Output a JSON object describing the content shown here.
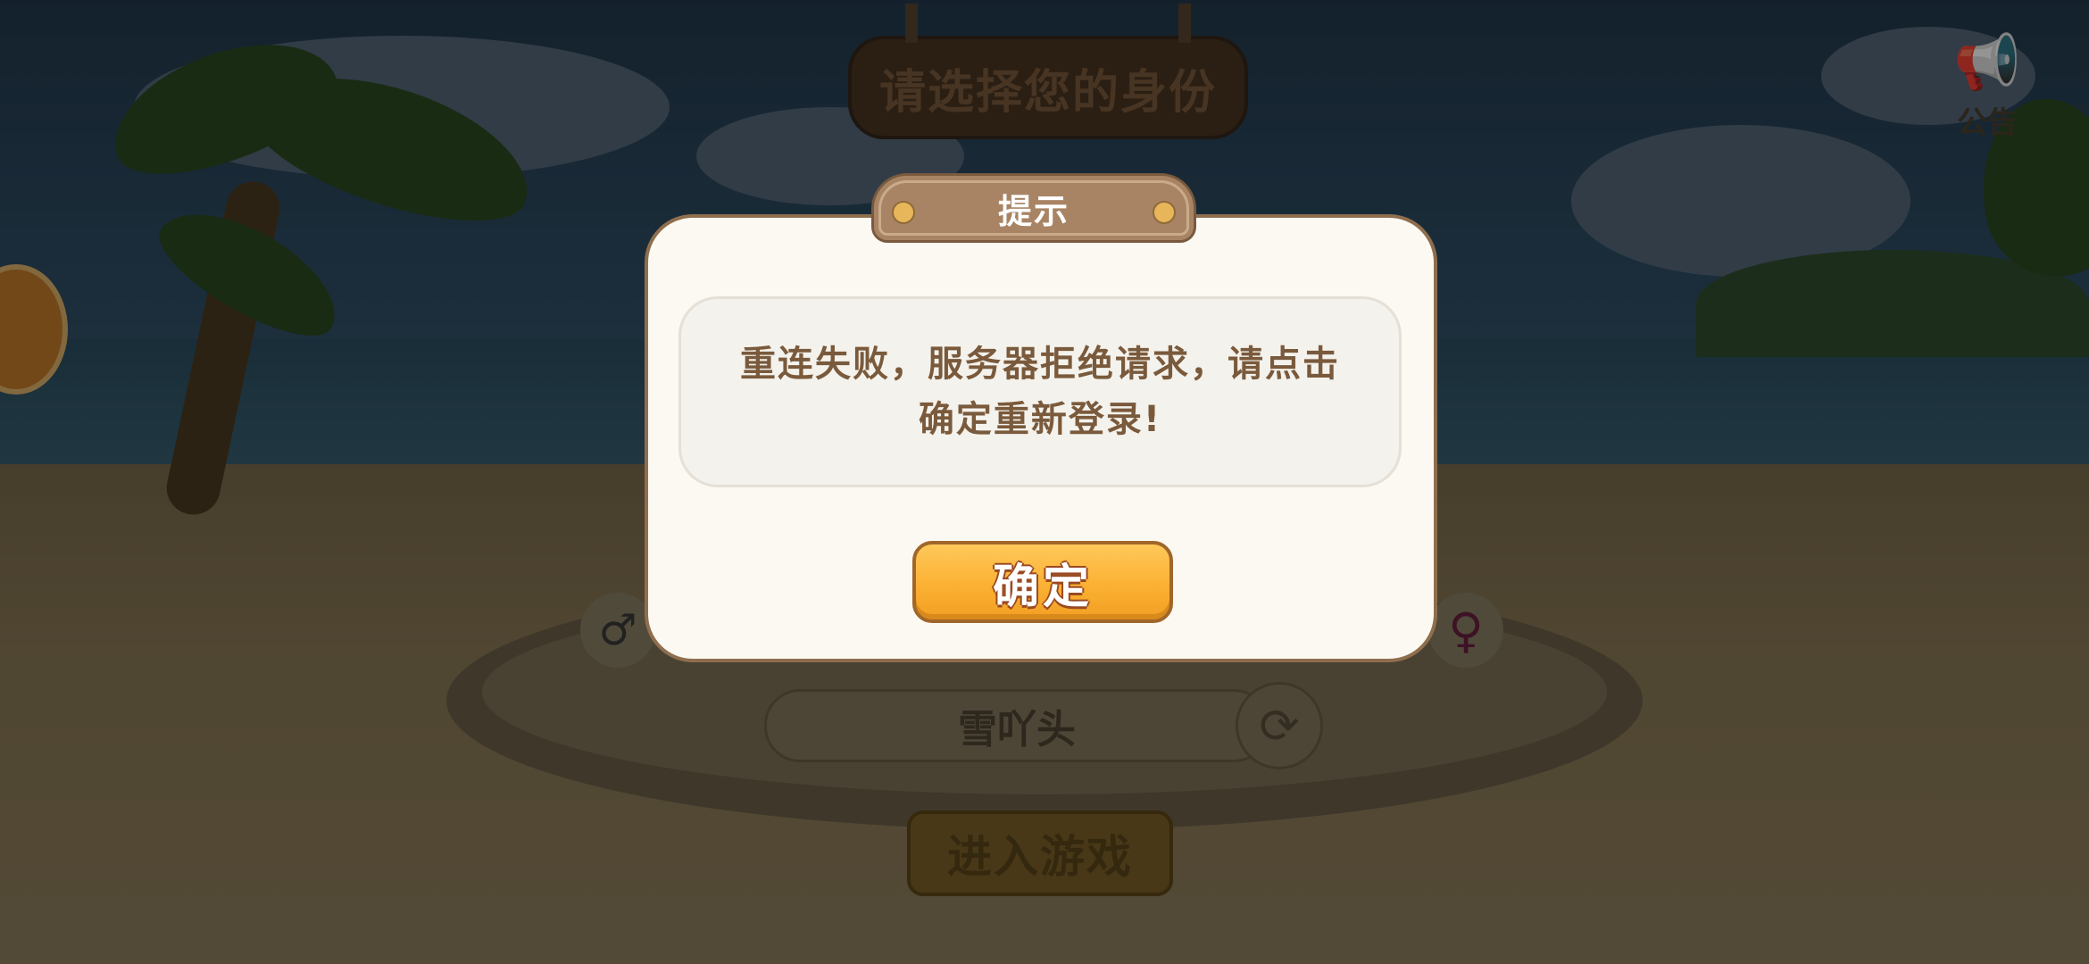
{
  "background_ui": {
    "title": "请选择您的身份",
    "notice_label": "公告",
    "nickname": "雪吖头",
    "enter_button_label": "进入游戏",
    "male_symbol": "♂",
    "female_symbol": "♀",
    "refresh_symbol": "⟳",
    "notice_icon": "📢"
  },
  "dialog": {
    "title": "提示",
    "message": "重连失败，服务器拒绝请求，请点击确定重新登录!",
    "confirm_label": "确定"
  },
  "colors": {
    "dialog_bg": "#fbf9f2",
    "dialog_border": "#8f6e4e",
    "confirm_button": "#fbb133",
    "message_text": "#7a5a3c"
  }
}
